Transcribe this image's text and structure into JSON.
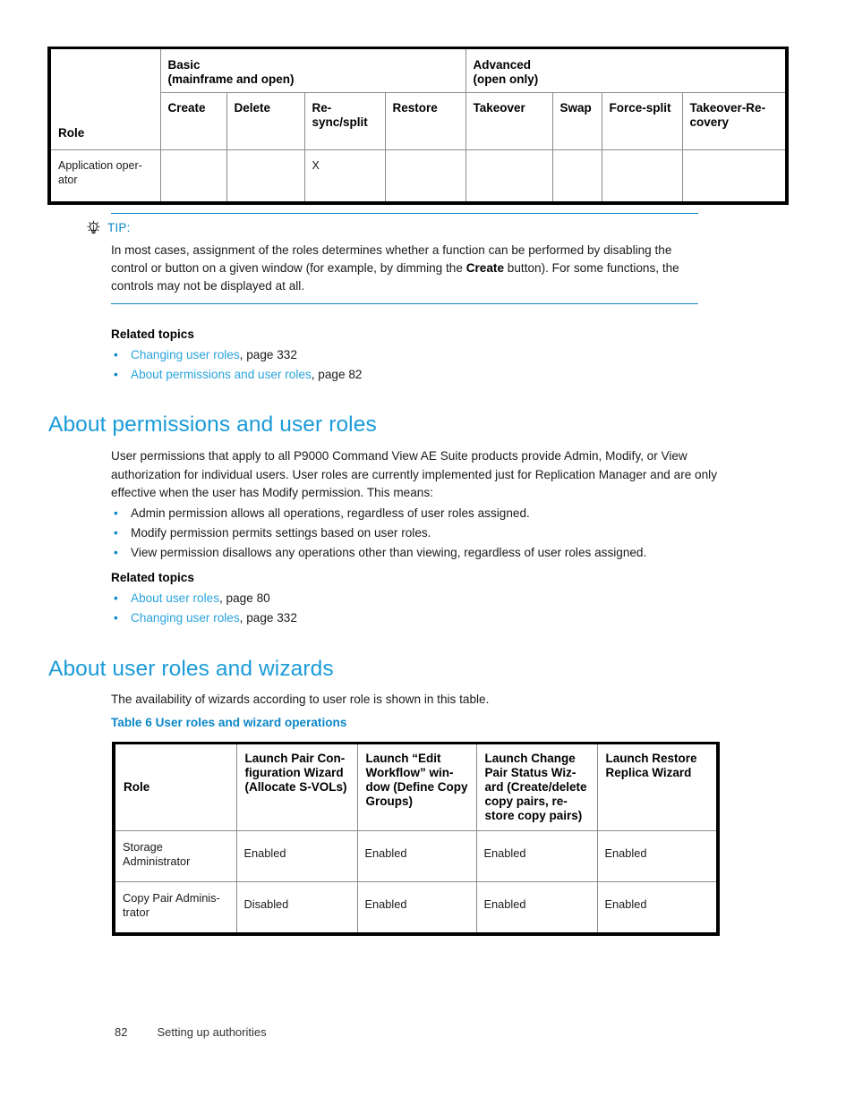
{
  "colors": {
    "heading_blue": "#1b9bd8",
    "link_blue": "#2aa3dd",
    "accent_blue": "#0b87c6",
    "rule_blue": "#0b87c6",
    "table_border": "#000000",
    "table_inner_border": "#8c8c8c"
  },
  "table_roles": {
    "group_headers": [
      {
        "label": "Role"
      },
      {
        "label": "Basic\n(mainframe and open)"
      },
      {
        "label": "Advanced\n(open only)"
      }
    ],
    "basic_group_line1": "Basic",
    "basic_group_line2": "(mainframe and open)",
    "advanced_group_line1": "Advanced",
    "advanced_group_line2": "(open only)",
    "role_header": "Role",
    "columns": [
      "Create",
      "Delete",
      "Re-sync/split",
      "Restore",
      "Takeover",
      "Swap",
      "Force-split",
      "Takeover-Recovery"
    ],
    "rows": [
      {
        "role": "Application operator",
        "cells": [
          "",
          "",
          "X",
          "",
          "",
          "",
          "",
          ""
        ]
      }
    ]
  },
  "tip": {
    "icon": "lightbulb-icon",
    "label": "TIP:",
    "text_part1": "In most cases, assignment of the roles determines whether a function can be performed by disabling the control or button on a given window (for example, by dimming the ",
    "emphasis": "Create",
    "text_part2": " button). For some functions, the controls may not be displayed at all."
  },
  "related_topics_1": {
    "heading": "Related topics",
    "items": [
      {
        "bullet": "•",
        "link": "Changing user roles",
        "suffix": ", page 332"
      },
      {
        "bullet": "•",
        "link": "About permissions and user roles",
        "suffix": ", page 82"
      }
    ]
  },
  "section_permissions": {
    "title": "About permissions and user roles",
    "body": "User permissions that apply to all P9000 Command View AE Suite products provide Admin, Modify, or View authorization for individual users. User roles are currently implemented just for Replication Manager and are only effective when the user has Modify permission. This means:",
    "bullets": [
      {
        "bullet": "•",
        "text": "Admin permission allows all operations, regardless of user roles assigned."
      },
      {
        "bullet": "•",
        "text": "Modify permission permits settings based on user roles."
      },
      {
        "bullet": "•",
        "text": "View permission disallows any operations other than viewing, regardless of user roles assigned."
      }
    ]
  },
  "related_topics_2": {
    "heading": "Related topics",
    "items": [
      {
        "bullet": "•",
        "link": "About user roles",
        "suffix": ", page 80"
      },
      {
        "bullet": "•",
        "link": "Changing user roles",
        "suffix": ", page 332"
      }
    ]
  },
  "section_wizards": {
    "title": "About user roles and wizards",
    "body": "The availability of wizards according to user role is shown in this table.",
    "table_caption": "Table 6 User roles and wizard operations"
  },
  "table_wizards": {
    "headers": [
      "Role",
      "Launch Pair Configuration Wizard (Allocate S-VOLs)",
      "Launch “Edit Workflow” window (Define Copy Groups)",
      "Launch Change Pair Status Wizard (Create/delete copy pairs, restore copy pairs)",
      "Launch Restore Replica Wizard"
    ],
    "rows": [
      {
        "role": "Storage Administrator",
        "cells": [
          "Enabled",
          "Enabled",
          "Enabled",
          "Enabled"
        ]
      },
      {
        "role": "Copy Pair Administrator",
        "cells": [
          "Disabled",
          "Enabled",
          "Enabled",
          "Enabled"
        ]
      }
    ]
  },
  "footer": {
    "page_number": "82",
    "chapter": "Setting up authorities"
  }
}
